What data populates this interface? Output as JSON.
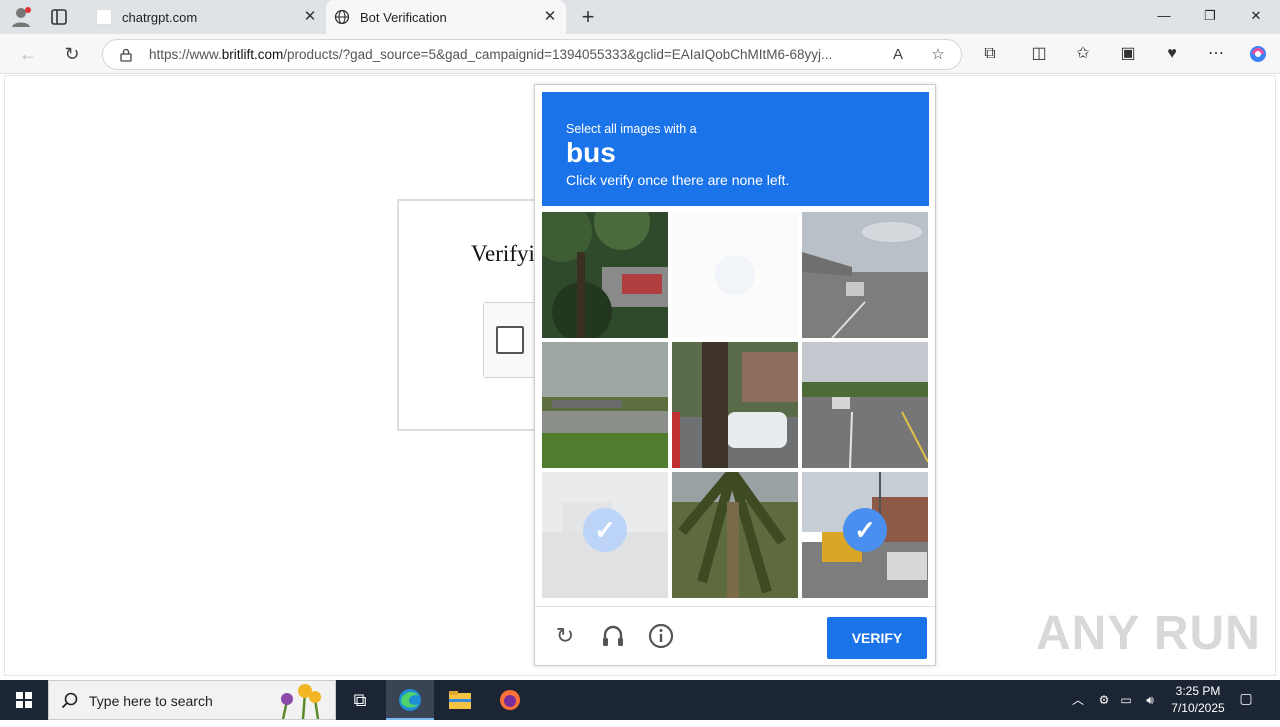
{
  "browser": {
    "tabs": [
      {
        "title": "chatrgpt.com",
        "active": false
      },
      {
        "title": "Bot Verification",
        "active": true
      }
    ],
    "new_tab_label": "+",
    "url_prefix": "https://www.",
    "url_domain": "britlift.com",
    "url_rest": "/products/?gad_source=5&gad_campaignid=1394055333&gclid=EAIaIQobChMItM6-68yyj..."
  },
  "page": {
    "heading": "Verifyi",
    "checkbox_checked": false
  },
  "captcha": {
    "instruction": "Select all images with a",
    "target": "bus",
    "sub_instruction": "Click verify once there are none left.",
    "tiles": [
      {
        "scene": "trees-car",
        "selected": false,
        "loading": false
      },
      {
        "scene": "blank",
        "selected": false,
        "loading": true
      },
      {
        "scene": "road-overpass",
        "selected": false,
        "loading": false
      },
      {
        "scene": "overpass-grass",
        "selected": false,
        "loading": false
      },
      {
        "scene": "tree-white-car",
        "selected": false,
        "loading": false
      },
      {
        "scene": "road-cars",
        "selected": false,
        "loading": false
      },
      {
        "scene": "faded-street",
        "selected": true,
        "loading": true
      },
      {
        "scene": "palm-tree",
        "selected": false,
        "loading": false
      },
      {
        "scene": "school-bus-street",
        "selected": true,
        "loading": false
      }
    ],
    "verify_label": "VERIFY",
    "colors": {
      "header": "#1a73e8",
      "button": "#1a73e8"
    }
  },
  "watermark": "ANY RUN",
  "taskbar": {
    "search_placeholder": "Type here to search",
    "time": "3:25 PM",
    "date": "7/10/2025"
  }
}
